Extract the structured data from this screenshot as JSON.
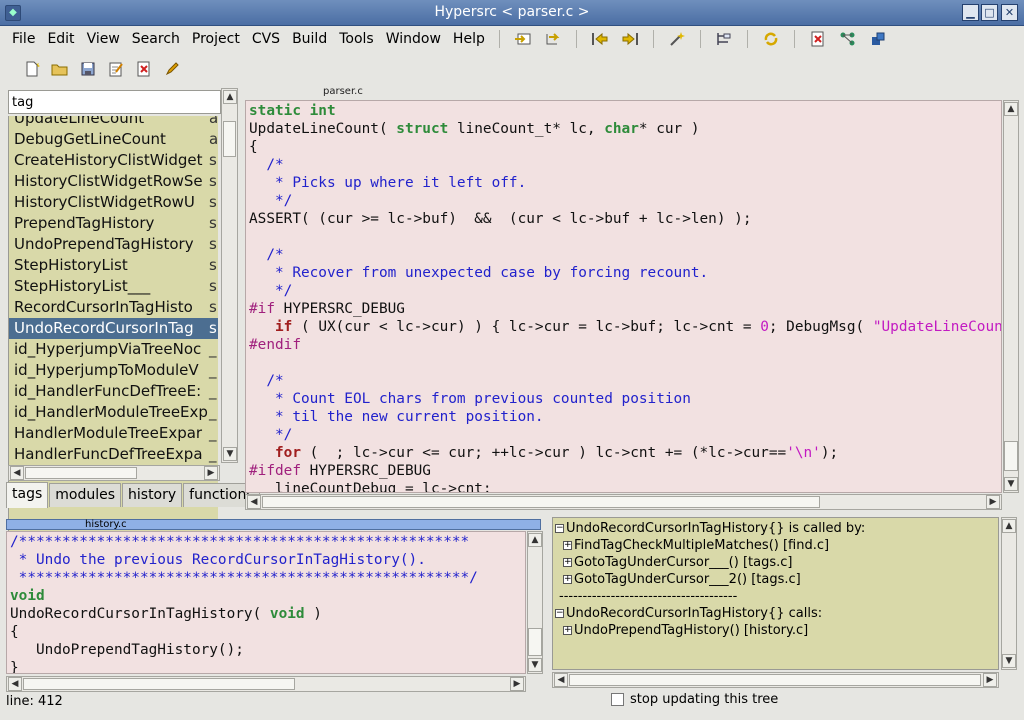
{
  "window": {
    "title": "Hypersrc < parser.c >",
    "min_label": "▁",
    "max_label": "□",
    "close_label": "✕"
  },
  "menubar": {
    "items": [
      {
        "label": "File"
      },
      {
        "label": "Edit"
      },
      {
        "label": "View"
      },
      {
        "label": "Search"
      },
      {
        "label": "Project"
      },
      {
        "label": "CVS"
      },
      {
        "label": "Build"
      },
      {
        "label": "Tools"
      },
      {
        "label": "Window"
      },
      {
        "label": "Help"
      }
    ]
  },
  "tagpanel": {
    "input_value": "tag",
    "rows": [
      {
        "name": "UpdateLineCount",
        "file": "a"
      },
      {
        "name": "DebugGetLineCount",
        "file": "a"
      },
      {
        "name": "CreateHistoryClistWidget",
        "file": "s"
      },
      {
        "name": "HistoryClistWidgetRowSe",
        "file": "s"
      },
      {
        "name": "HistoryClistWidgetRowU",
        "file": "s"
      },
      {
        "name": "PrependTagHistory",
        "file": "s"
      },
      {
        "name": "UndoPrependTagHistory",
        "file": "s"
      },
      {
        "name": "StepHistoryList",
        "file": "s"
      },
      {
        "name": "StepHistoryList___",
        "file": "s"
      },
      {
        "name": "RecordCursorInTagHisto",
        "file": "s"
      },
      {
        "name": "UndoRecordCursorInTag",
        "file": "s"
      },
      {
        "name": "id_HyperjumpViaTreeNoc",
        "file": "_"
      },
      {
        "name": "id_HyperjumpToModuleV",
        "file": "_"
      },
      {
        "name": "id_HandlerFuncDefTreeE:",
        "file": "_"
      },
      {
        "name": "id_HandlerModuleTreeExp",
        "file": "_"
      },
      {
        "name": "HandlerModuleTreeExpar",
        "file": "_"
      },
      {
        "name": "HandlerFuncDefTreeExpa",
        "file": "_"
      }
    ],
    "selected_index": 10,
    "tabs": [
      {
        "label": "tags",
        "active": true
      },
      {
        "label": "modules",
        "active": false
      },
      {
        "label": "history",
        "active": false
      },
      {
        "label": "functions",
        "active": false
      }
    ]
  },
  "editor": {
    "filename": "parser.c"
  },
  "editor2": {
    "filename": "history.c"
  },
  "calltree": {
    "called_by_header": "UndoRecordCursorInTagHistory{} is called by:",
    "called_by": [
      "FindTagCheckMultipleMatches()  [find.c]",
      "GotoTagUnderCursor___()  [tags.c]",
      "GotoTagUnderCursor___2()  [tags.c]"
    ],
    "separator": "--------------------------------------",
    "calls_header": "UndoRecordCursorInTagHistory{} calls:",
    "calls": [
      "UndoPrependTagHistory()  [history.c]"
    ]
  },
  "statusbar": {
    "line": "line: 412",
    "stop_updating_label": "stop updating this tree"
  },
  "colors": {
    "titlebar": "#4b6ea4",
    "tag_list_bg": "#d9d9a9",
    "editor_bg": "#f2e1e1",
    "selection": "#4c6e91"
  }
}
